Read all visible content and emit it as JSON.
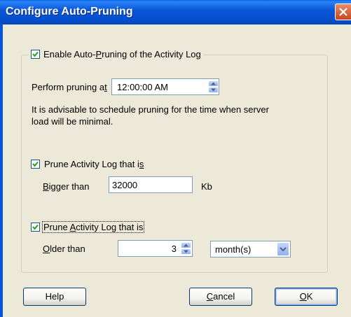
{
  "window": {
    "title": "Configure Auto-Pruning"
  },
  "enable": {
    "checked": true,
    "label_pre": "Enable Auto-",
    "label_u": "P",
    "label_post": "runing of the Activity Log"
  },
  "schedule": {
    "label_pre": "Perform pruning a",
    "label_u": "t",
    "time": "12:00:00 AM"
  },
  "advice": {
    "line1": "It is advisable to schedule pruning for the time when server",
    "line2": "load will be minimal."
  },
  "size_rule": {
    "checked": true,
    "label_pre": "Prune Activity Log that i",
    "label_u": "s",
    "bigger_u": "B",
    "bigger_post": "igger than",
    "value": "32000",
    "unit": "Kb"
  },
  "age_rule": {
    "checked": true,
    "label_pre": "Prune ",
    "label_u": "A",
    "label_post": "ctivity Log that is",
    "older_u": "O",
    "older_post": "lder than",
    "value": "3",
    "unit_selected": "month(s)"
  },
  "buttons": {
    "help": "Help",
    "cancel_u": "C",
    "cancel_post": "ancel",
    "ok_u": "O",
    "ok_post": "K"
  }
}
